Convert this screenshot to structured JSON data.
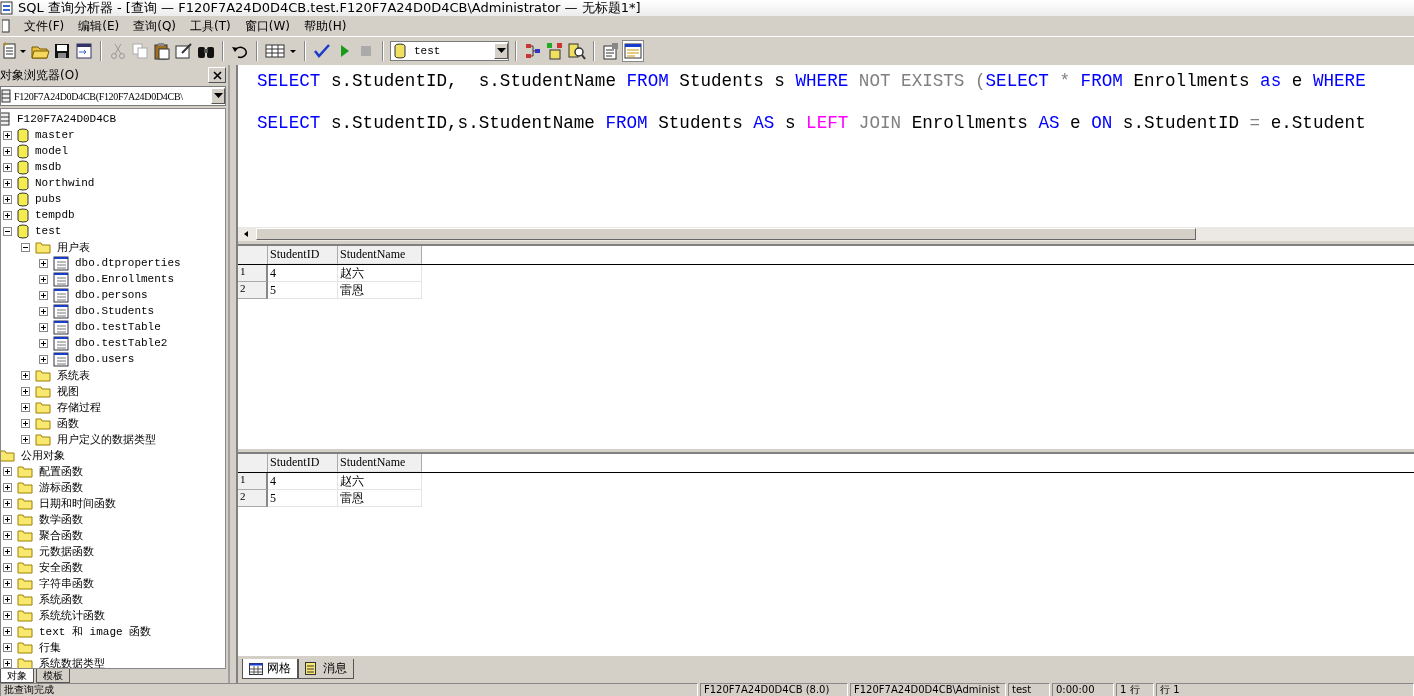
{
  "window": {
    "title": "SQL 查询分析器 - [查询 — F120F7A24D0D4CB.test.F120F7A24D0D4CB\\Administrator — 无标题1*]"
  },
  "menu": [
    "文件(F)",
    "编辑(E)",
    "查询(Q)",
    "工具(T)",
    "窗口(W)",
    "帮助(H)"
  ],
  "toolbar": {
    "database": "test"
  },
  "object_browser": {
    "title": "对象浏览器(O)",
    "server_select": "F120F7A24D0D4CB(F120F7A24D0D4CB\\",
    "tree": [
      {
        "label": "F120F7A24D0D4CB",
        "kind": "server",
        "children": [
          {
            "label": "master",
            "kind": "db",
            "expanded": false
          },
          {
            "label": "model",
            "kind": "db",
            "expanded": false
          },
          {
            "label": "msdb",
            "kind": "db",
            "expanded": false
          },
          {
            "label": "Northwind",
            "kind": "db",
            "expanded": false
          },
          {
            "label": "pubs",
            "kind": "db",
            "expanded": false
          },
          {
            "label": "tempdb",
            "kind": "db",
            "expanded": false
          },
          {
            "label": "test",
            "kind": "db",
            "expanded": true,
            "children": [
              {
                "label": "用户表",
                "kind": "folder",
                "expanded": true,
                "children": [
                  {
                    "label": "dbo.dtproperties",
                    "kind": "table",
                    "expanded": false
                  },
                  {
                    "label": "dbo.Enrollments",
                    "kind": "table",
                    "expanded": false
                  },
                  {
                    "label": "dbo.persons",
                    "kind": "table",
                    "expanded": false
                  },
                  {
                    "label": "dbo.Students",
                    "kind": "table",
                    "expanded": false
                  },
                  {
                    "label": "dbo.testTable",
                    "kind": "table",
                    "expanded": false
                  },
                  {
                    "label": "dbo.testTable2",
                    "kind": "table",
                    "expanded": false
                  },
                  {
                    "label": "dbo.users",
                    "kind": "table",
                    "expanded": false
                  }
                ]
              },
              {
                "label": "系统表",
                "kind": "folder",
                "expanded": false
              },
              {
                "label": "视图",
                "kind": "folder",
                "expanded": false
              },
              {
                "label": "存储过程",
                "kind": "folder",
                "expanded": false
              },
              {
                "label": "函数",
                "kind": "folder",
                "expanded": false
              },
              {
                "label": "用户定义的数据类型",
                "kind": "folder",
                "expanded": false
              }
            ]
          }
        ]
      },
      {
        "label": "公用对象",
        "kind": "folder",
        "children": [
          {
            "label": "配置函数",
            "kind": "folder",
            "expanded": false
          },
          {
            "label": "游标函数",
            "kind": "folder",
            "expanded": false
          },
          {
            "label": "日期和时间函数",
            "kind": "folder",
            "expanded": false
          },
          {
            "label": "数学函数",
            "kind": "folder",
            "expanded": false
          },
          {
            "label": "聚合函数",
            "kind": "folder",
            "expanded": false
          },
          {
            "label": "元数据函数",
            "kind": "folder",
            "expanded": false
          },
          {
            "label": "安全函数",
            "kind": "folder",
            "expanded": false
          },
          {
            "label": "字符串函数",
            "kind": "folder",
            "expanded": false
          },
          {
            "label": "系统函数",
            "kind": "folder",
            "expanded": false
          },
          {
            "label": "系统统计函数",
            "kind": "folder",
            "expanded": false
          },
          {
            "label": "text 和 image 函数",
            "kind": "folder",
            "expanded": false
          },
          {
            "label": "行集",
            "kind": "folder",
            "expanded": false
          },
          {
            "label": "系统数据类型",
            "kind": "folder",
            "expanded": false
          }
        ]
      }
    ],
    "tabs": [
      {
        "label": "对象",
        "selected": true
      },
      {
        "label": "模板",
        "selected": false
      }
    ]
  },
  "editor": {
    "lines": [
      [
        {
          "kind": "keyword",
          "text": "SELECT"
        },
        {
          "kind": "plain",
          "text": " s.StudentID,  s.StudentName "
        },
        {
          "kind": "keyword",
          "text": "FROM"
        },
        {
          "kind": "plain",
          "text": " Students s "
        },
        {
          "kind": "keyword",
          "text": "WHERE"
        },
        {
          "kind": "operator",
          "text": " NOT EXISTS ("
        },
        {
          "kind": "keyword",
          "text": "SELECT"
        },
        {
          "kind": "operator",
          "text": " * "
        },
        {
          "kind": "keyword",
          "text": "FROM"
        },
        {
          "kind": "plain",
          "text": " Enrollments "
        },
        {
          "kind": "keyword",
          "text": "as"
        },
        {
          "kind": "plain",
          "text": " e "
        },
        {
          "kind": "keyword",
          "text": "WHERE"
        }
      ],
      [
        {
          "kind": "keyword",
          "text": "SELECT"
        },
        {
          "kind": "plain",
          "text": " s.StudentID,s.StudentName "
        },
        {
          "kind": "keyword",
          "text": "FROM"
        },
        {
          "kind": "plain",
          "text": " Students "
        },
        {
          "kind": "keyword",
          "text": "AS"
        },
        {
          "kind": "plain",
          "text": " s "
        },
        {
          "kind": "function",
          "text": "LEFT"
        },
        {
          "kind": "operator",
          "text": " JOIN "
        },
        {
          "kind": "plain",
          "text": "Enrollments "
        },
        {
          "kind": "keyword",
          "text": "AS"
        },
        {
          "kind": "plain",
          "text": " e "
        },
        {
          "kind": "keyword",
          "text": "ON"
        },
        {
          "kind": "plain",
          "text": " s.StudentID "
        },
        {
          "kind": "operator",
          "text": "="
        },
        {
          "kind": "plain",
          "text": " e.Student"
        }
      ]
    ]
  },
  "results": [
    {
      "columns": [
        "StudentID",
        "StudentName"
      ],
      "rows": [
        {
          "number": "1",
          "cells": [
            "4",
            "赵六"
          ]
        },
        {
          "number": "2",
          "cells": [
            "5",
            "雷恩"
          ]
        }
      ]
    },
    {
      "columns": [
        "StudentID",
        "StudentName"
      ],
      "rows": [
        {
          "number": "1",
          "cells": [
            "4",
            "赵六"
          ]
        },
        {
          "number": "2",
          "cells": [
            "5",
            "雷恩"
          ]
        }
      ]
    }
  ],
  "result_tabs": [
    {
      "label": "网格",
      "kind": "grid",
      "selected": true
    },
    {
      "label": "消息",
      "kind": "messages",
      "selected": false
    }
  ],
  "status_bar": [
    "批查询完成",
    "F120F7A24D0D4CB (8.0)",
    "F120F7A24D0D4CB\\Administ",
    "test",
    "0:00:00",
    "1 行",
    "行 1"
  ]
}
